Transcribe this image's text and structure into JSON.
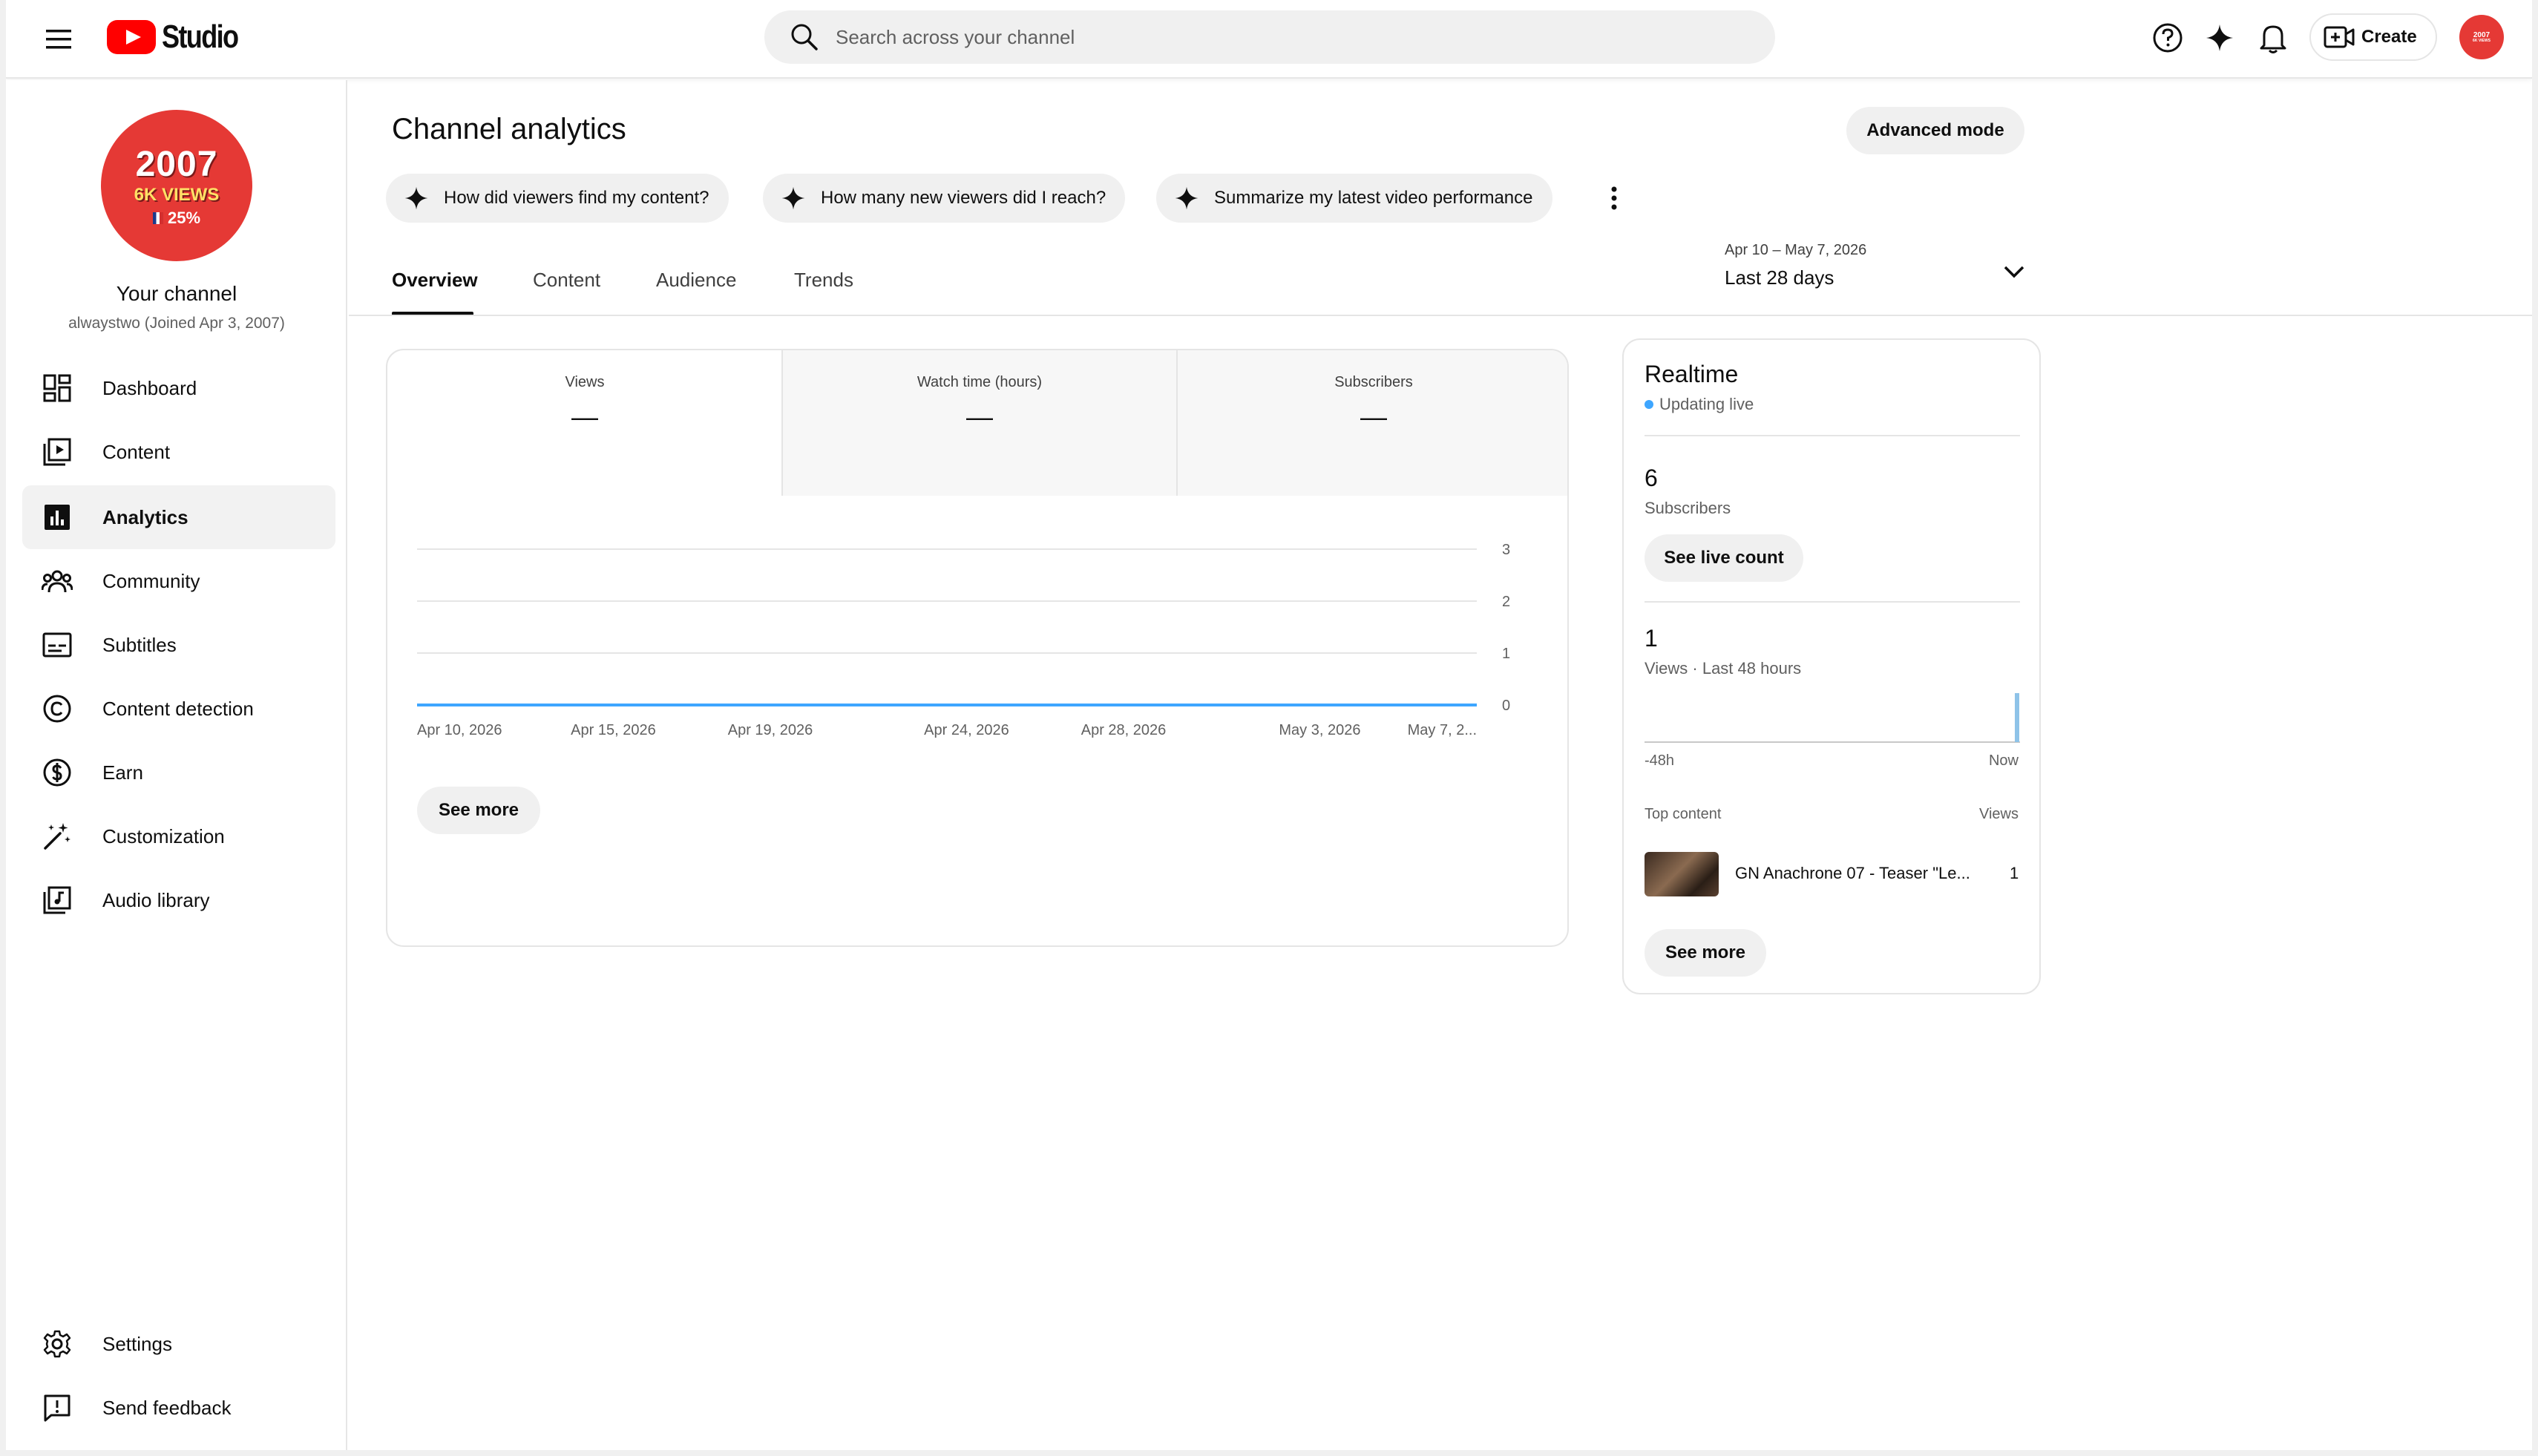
{
  "header": {
    "brand": "Studio",
    "search_placeholder": "Search across your channel",
    "create_label": "Create",
    "avatar_text_top": "2007",
    "avatar_text_bottom": "6K VIEWS"
  },
  "sidebar": {
    "avatar": {
      "line1": "2007",
      "line2": "6K VIEWS",
      "line3": "25%"
    },
    "channel_name": "Your channel",
    "channel_sub": "alwaystwo (Joined Apr 3, 2007)",
    "items": [
      {
        "label": "Dashboard",
        "icon": "dashboard-icon"
      },
      {
        "label": "Content",
        "icon": "content-icon"
      },
      {
        "label": "Analytics",
        "icon": "analytics-icon",
        "active": true
      },
      {
        "label": "Community",
        "icon": "community-icon"
      },
      {
        "label": "Subtitles",
        "icon": "subtitles-icon"
      },
      {
        "label": "Content detection",
        "icon": "copyright-icon"
      },
      {
        "label": "Earn",
        "icon": "dollar-icon"
      },
      {
        "label": "Customization",
        "icon": "magic-wand-icon"
      },
      {
        "label": "Audio library",
        "icon": "audio-library-icon"
      }
    ],
    "bottom_items": [
      {
        "label": "Settings",
        "icon": "gear-icon"
      },
      {
        "label": "Send feedback",
        "icon": "feedback-icon"
      }
    ]
  },
  "main": {
    "title": "Channel analytics",
    "advanced_mode": "Advanced mode",
    "chips": [
      "How did viewers find my content?",
      "How many new viewers did I reach?",
      "Summarize my latest video performance"
    ],
    "tabs": [
      "Overview",
      "Content",
      "Audience",
      "Trends"
    ],
    "active_tab": "Overview",
    "date_range": "Apr 10 – May 7, 2026",
    "date_preset": "Last 28 days",
    "metrics": [
      {
        "title": "Views",
        "value": "—"
      },
      {
        "title": "Watch time (hours)",
        "value": "—"
      },
      {
        "title": "Subscribers",
        "value": "—"
      }
    ],
    "see_more": "See more"
  },
  "chart_data": {
    "type": "line",
    "x_tick_labels": [
      "Apr 10, 2026",
      "Apr 15, 2026",
      "Apr 19, 2026",
      "Apr 24, 2026",
      "Apr 28, 2026",
      "May 3, 2026",
      "May 7, 2..."
    ],
    "y_ticks": [
      0,
      1,
      2,
      3
    ],
    "ylim": [
      0,
      3
    ],
    "grid": true,
    "series": [
      {
        "values": [
          0,
          0,
          0,
          0,
          0,
          0,
          0,
          0,
          0,
          0,
          0,
          0,
          0,
          0,
          0,
          0,
          0,
          0,
          0,
          0,
          0,
          0,
          0,
          0,
          0,
          0,
          0,
          0
        ]
      }
    ],
    "color": "#3ea6ff"
  },
  "realtime": {
    "title": "Realtime",
    "live_label": "Updating live",
    "subscribers_value": "6",
    "subscribers_label": "Subscribers",
    "see_live_count": "See live count",
    "views_value": "1",
    "views_label": "Views · Last 48 hours",
    "axis_start": "-48h",
    "axis_end": "Now",
    "top_content_label": "Top content",
    "views_col_label": "Views",
    "top_video_title": "GN Anachrone 07 - Teaser \"Le...",
    "top_video_views": "1",
    "see_more": "See more",
    "bars": [
      0,
      0,
      0,
      0,
      0,
      0,
      0,
      0,
      0,
      0,
      0,
      0,
      0,
      0,
      0,
      0,
      0,
      0,
      0,
      0,
      0,
      0,
      0,
      0,
      0,
      0,
      0,
      0,
      0,
      0,
      0,
      0,
      0,
      0,
      0,
      0,
      0,
      0,
      0,
      0,
      0,
      0,
      0,
      0,
      0,
      0,
      0,
      1
    ]
  }
}
